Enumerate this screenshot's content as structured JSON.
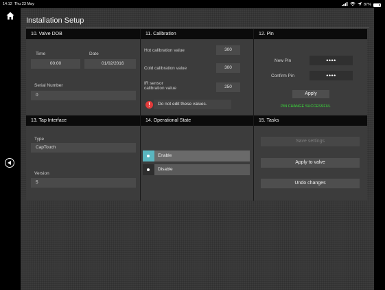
{
  "statusbar": {
    "time": "14:12",
    "date": "Thu 23 May",
    "battery": "87%",
    "battery_level": 0.87
  },
  "colors": {
    "accent": "#5ab6c0",
    "success": "#3be03b",
    "warning": "#e23b3b",
    "header_bg": "#0b0b0b"
  },
  "icons": {
    "home": "home-icon",
    "back": "back-arrow-icon",
    "warning": "warning-icon"
  },
  "page_title": "Installation Setup",
  "valve_dob": {
    "header": "10. Valve DOB",
    "time_label": "Time",
    "time_value": "00:00",
    "date_label": "Date",
    "date_value": "01/02/2016",
    "serial_label": "Serial Number",
    "serial_value": "0"
  },
  "calibration": {
    "header": "11. Calibration",
    "hot_label": "Hot calibration value",
    "hot_value": "300",
    "cold_label": "Cold calibration value",
    "cold_value": "300",
    "ir_label_line1": "IR sensor",
    "ir_label_line2": "calibration value",
    "ir_value": "250",
    "warning_icon_glyph": "!",
    "warning_text": "Do not edit these values."
  },
  "pin": {
    "header": "12. Pin",
    "new_pin_label": "New Pin",
    "new_pin_value": "••••",
    "confirm_pin_label": "Confirm Pin",
    "confirm_pin_value": "••••",
    "apply_label": "Apply",
    "status_text": "PIN CHANGE SUCCESSFUL"
  },
  "tap_interface": {
    "header": "13. Tap Interface",
    "type_label": "Type",
    "type_value": "CapTouch",
    "version_label": "Version",
    "version_value": "5"
  },
  "operational_state": {
    "header": "14. Operational State",
    "enable_label": "Enable",
    "disable_label": "Disable",
    "selected": "Enable"
  },
  "tasks": {
    "header": "15. Tasks",
    "save_label": "Save settings",
    "apply_label": "Apply to valve",
    "undo_label": "Undo changes"
  }
}
